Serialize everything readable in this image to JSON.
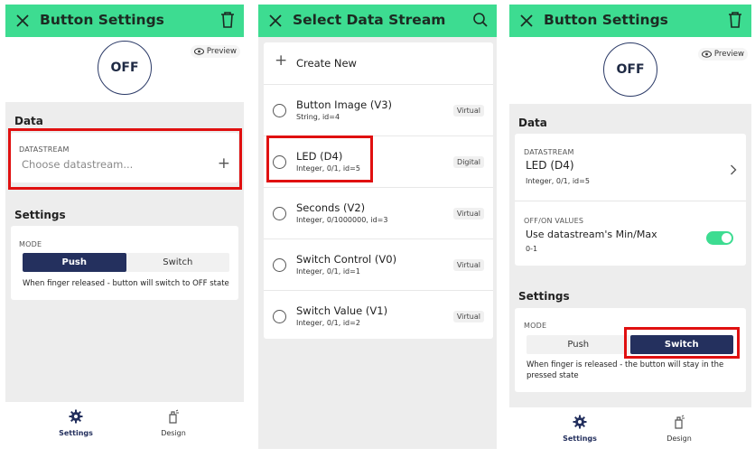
{
  "panel1": {
    "title": "Button Settings",
    "button_state": "OFF",
    "preview_label": "Preview",
    "data_section": "Data",
    "datastream_label": "DATASTREAM",
    "datastream_placeholder": "Choose datastream...",
    "settings_section": "Settings",
    "mode_label": "MODE",
    "mode_push": "Push",
    "mode_switch": "Switch",
    "mode_selected": "Push",
    "help_text": "When finger released - button will switch to OFF state",
    "tab_settings": "Settings",
    "tab_design": "Design"
  },
  "panel2": {
    "title": "Select Data Stream",
    "create_new": "Create New",
    "streams": [
      {
        "name": "Button Image (V3)",
        "detail": "String, id=4",
        "type": "Virtual"
      },
      {
        "name": "LED (D4)",
        "detail": "Integer, 0/1, id=5",
        "type": "Digital"
      },
      {
        "name": "Seconds (V2)",
        "detail": "Integer, 0/1000000, id=3",
        "type": "Virtual"
      },
      {
        "name": "Switch Control (V0)",
        "detail": "Integer, 0/1, id=1",
        "type": "Virtual"
      },
      {
        "name": "Switch Value (V1)",
        "detail": "Integer, 0/1, id=2",
        "type": "Virtual"
      }
    ]
  },
  "panel3": {
    "title": "Button Settings",
    "button_state": "OFF",
    "preview_label": "Preview",
    "data_section": "Data",
    "datastream_label": "DATASTREAM",
    "datastream_value": "LED (D4)",
    "datastream_detail": "Integer, 0/1, id=5",
    "onoff_label": "OFF/ON VALUES",
    "onoff_value": "Use datastream's Min/Max",
    "onoff_range": "0-1",
    "onoff_enabled": true,
    "settings_section": "Settings",
    "mode_label": "MODE",
    "mode_push": "Push",
    "mode_switch": "Switch",
    "mode_selected": "Switch",
    "help_text": "When finger is released - the button will stay in the pressed state",
    "tab_settings": "Settings",
    "tab_design": "Design"
  },
  "colors": {
    "header_green": "#3ddc91",
    "accent_navy": "#24305e",
    "highlight_red": "#e01010"
  }
}
